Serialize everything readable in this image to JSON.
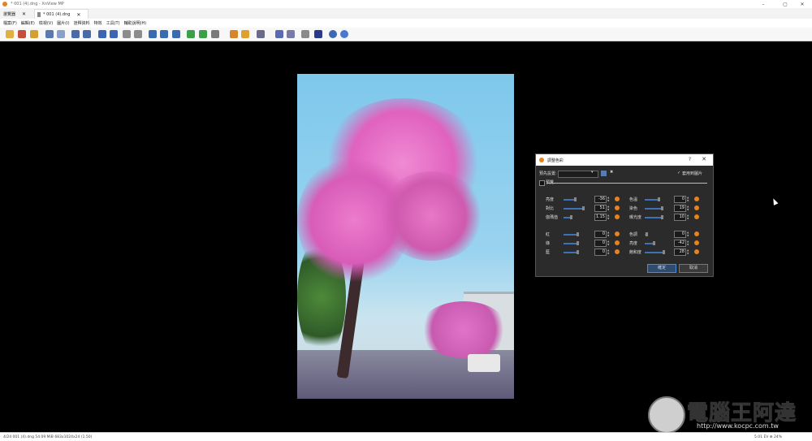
{
  "window": {
    "title": "* 001 (4).dng - XnView MP",
    "controls": [
      "–",
      "▢",
      "✕"
    ]
  },
  "tabs": [
    {
      "label": "瀏覽器",
      "close": "✕"
    },
    {
      "label": "* 001 (4).dng",
      "close": "✕"
    }
  ],
  "menu": [
    "檔案(F)",
    "編輯(E)",
    "檢視(V)",
    "圖片(I)",
    "詮釋資料",
    "特效",
    "工具(T)",
    "輔助說明(H)"
  ],
  "dialog": {
    "title": "調整色彩",
    "help": "?",
    "close": "✕",
    "preset_label": "預先設置:",
    "preset_value": "",
    "apply_to_image": "套用到圖片",
    "preview_label": "預覽",
    "left_rows": [
      {
        "label": "亮度",
        "value": "-36"
      },
      {
        "label": "對比",
        "value": "51"
      },
      {
        "label": "伽瑪值",
        "value": "1.15"
      },
      {
        "label": "紅",
        "value": "0"
      },
      {
        "label": "綠",
        "value": "0"
      },
      {
        "label": "藍",
        "value": "0"
      }
    ],
    "right_rows": [
      {
        "label": "色溫",
        "value": "0"
      },
      {
        "label": "染色",
        "value": "19"
      },
      {
        "label": "曝光度",
        "value": "10"
      },
      {
        "label": "色調",
        "value": "0"
      },
      {
        "label": "亮度",
        "value": "-42"
      },
      {
        "label": "飽和度",
        "value": "28"
      }
    ],
    "ok": "確定",
    "cancel": "取消"
  },
  "status": {
    "left": "4/24  001 (4).dng  54.09 MiB  683x1024x24 (1.50)",
    "right": "5.01 EV   ⊕   24%"
  },
  "watermark": {
    "text": "電腦王阿達",
    "url": "http://www.kocpc.com.tw"
  },
  "colors": {
    "accent": "#e8821e",
    "slider": "#3d72b4",
    "dialog_bg": "#2b2b2b"
  }
}
